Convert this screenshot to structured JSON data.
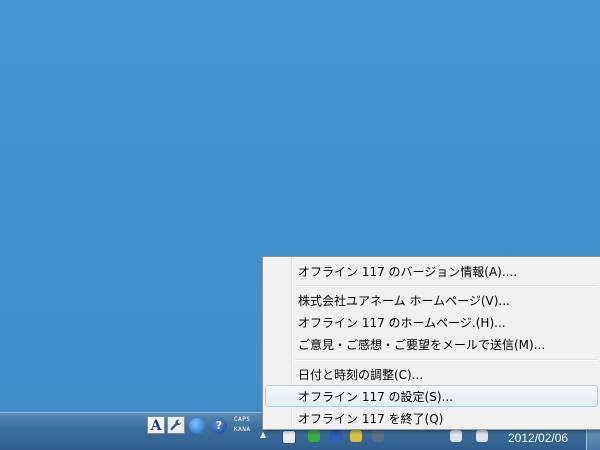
{
  "desktop": {
    "background_color": "#4392d0"
  },
  "context_menu": {
    "items": [
      {
        "label": "オフライン 117 のバージョン情報(A)...."
      },
      {
        "label": "株式会社ユアネーム ホームページ(V)..."
      },
      {
        "label": "オフライン 117 のホームページ.(H)..."
      },
      {
        "label": "ご意見・ご感想・ご要望をメールで送信(M)..."
      },
      {
        "label": "日付と時刻の調整(C)..."
      },
      {
        "label": "オフライン 117 の設定(S)...",
        "highlighted": true
      },
      {
        "label": "オフライン 117 を終了(Q)"
      }
    ],
    "highlight_color": "#e3ecf7"
  },
  "taskbar": {
    "ime_mode": "A",
    "help_glyph": "?",
    "caps_label": "CAPS",
    "kana_label": "KANA",
    "overflow_glyph": "▲",
    "clock": {
      "date": "2012/02/06"
    }
  }
}
